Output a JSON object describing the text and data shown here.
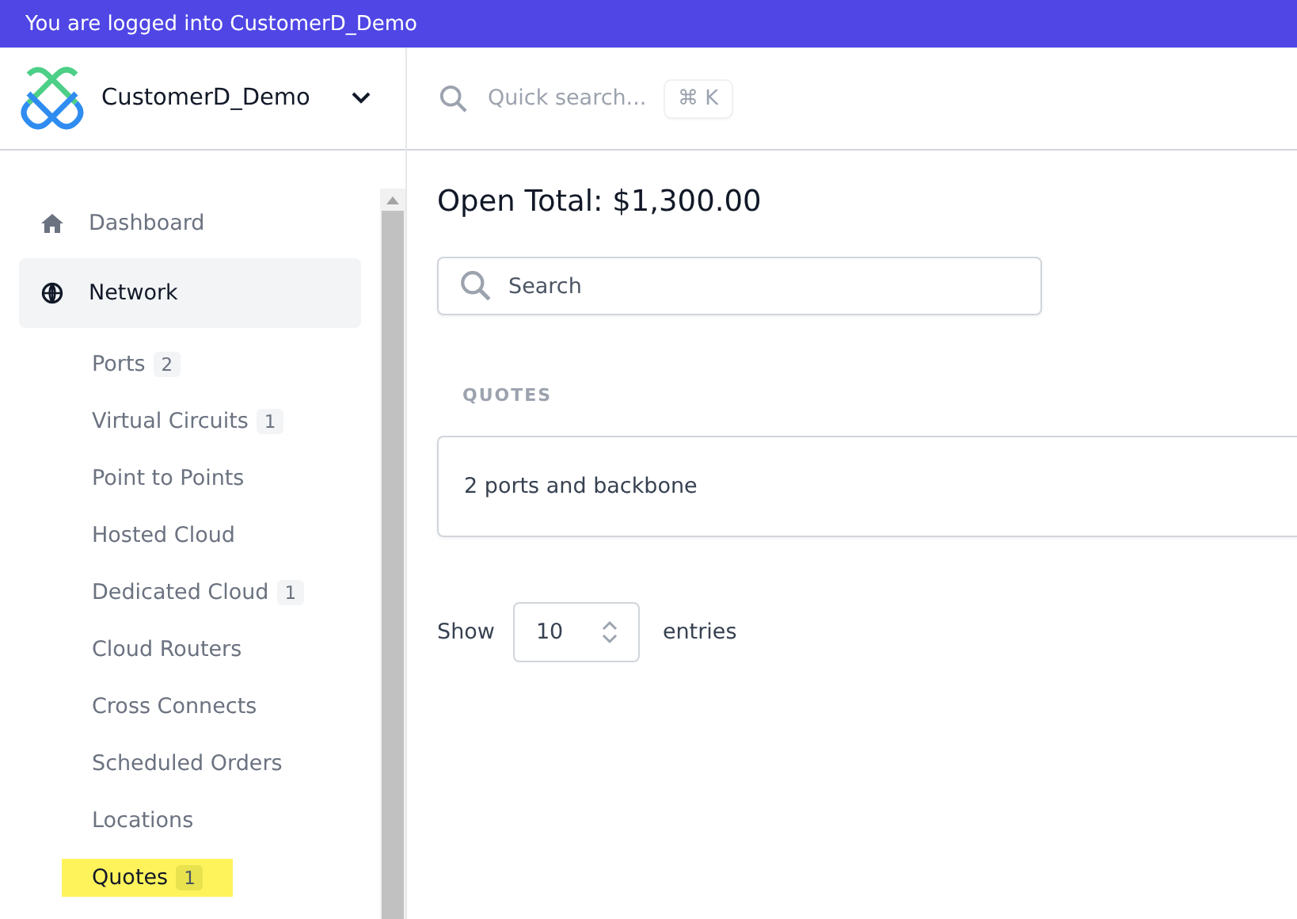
{
  "banner": {
    "text": "You are logged into CustomerD_Demo"
  },
  "account": {
    "name": "CustomerD_Demo"
  },
  "quick_search": {
    "placeholder": "Quick search...",
    "shortcut": [
      "⌘",
      "K"
    ]
  },
  "sidebar": {
    "items": [
      {
        "label": "Dashboard",
        "selected": false
      },
      {
        "label": "Network",
        "selected": true,
        "children": [
          {
            "label": "Ports",
            "badge": "2",
            "selected": false
          },
          {
            "label": "Virtual Circuits",
            "badge": "1",
            "selected": false
          },
          {
            "label": "Point to Points",
            "selected": false
          },
          {
            "label": "Hosted Cloud",
            "selected": false
          },
          {
            "label": "Dedicated Cloud",
            "badge": "1",
            "selected": false
          },
          {
            "label": "Cloud Routers",
            "selected": false
          },
          {
            "label": "Cross Connects",
            "selected": false
          },
          {
            "label": "Scheduled Orders",
            "selected": false
          },
          {
            "label": "Locations",
            "selected": false
          },
          {
            "label": "Quotes",
            "badge": "1",
            "selected": true
          }
        ]
      }
    ]
  },
  "main": {
    "title": "Open Total: $1,300.00",
    "search": {
      "placeholder": "Search"
    },
    "section_label": "QUOTES",
    "quotes": [
      {
        "name": "2 ports and backbone"
      }
    ],
    "entries": {
      "before": "Show",
      "value": "10",
      "after": "entries"
    }
  }
}
